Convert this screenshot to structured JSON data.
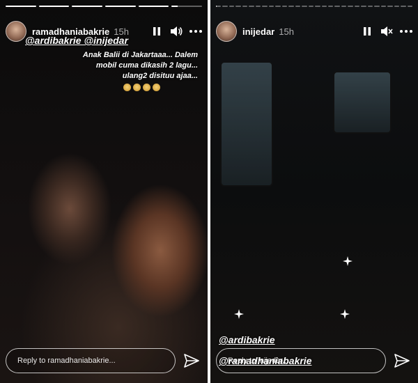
{
  "stories": [
    {
      "username": "ramadhaniabakrie",
      "time": "15h",
      "progress": [
        1,
        1,
        1,
        1,
        1,
        0.2
      ],
      "mentions": [
        "@ardibakrie @inijedar"
      ],
      "caption": "Anak Balii di Jakartaaa... Dalem mobil cuma dikasih 2 lagu... ulang2 disituu ajaa...",
      "emoji": [
        "see-no-evil-monkey",
        "see-no-evil-monkey",
        "see-no-evil-monkey",
        "see-no-evil-monkey"
      ],
      "reply_placeholder": "Reply to ramadhaniabakrie...",
      "audio": "on"
    },
    {
      "username": "inijedar",
      "time": "15h",
      "progress": [
        0.15,
        0,
        0,
        0,
        0,
        0,
        0,
        0,
        0,
        0,
        0,
        0,
        0,
        0,
        0,
        0,
        0,
        0,
        0,
        0,
        0,
        0,
        0,
        0,
        0,
        0,
        0,
        0,
        0,
        0
      ],
      "mentions": [
        "@ardibakrie",
        "@ramadhaniabakrie"
      ],
      "reply_placeholder": "Reply to inijedar...",
      "audio": "muted"
    }
  ],
  "colors": {
    "text": "#ffffff",
    "muted": "#bfbfbf",
    "background": "#0a0a0a"
  },
  "icons": [
    "pause-icon",
    "volume-icon",
    "volume-muted-icon",
    "more-icon",
    "send-icon"
  ]
}
